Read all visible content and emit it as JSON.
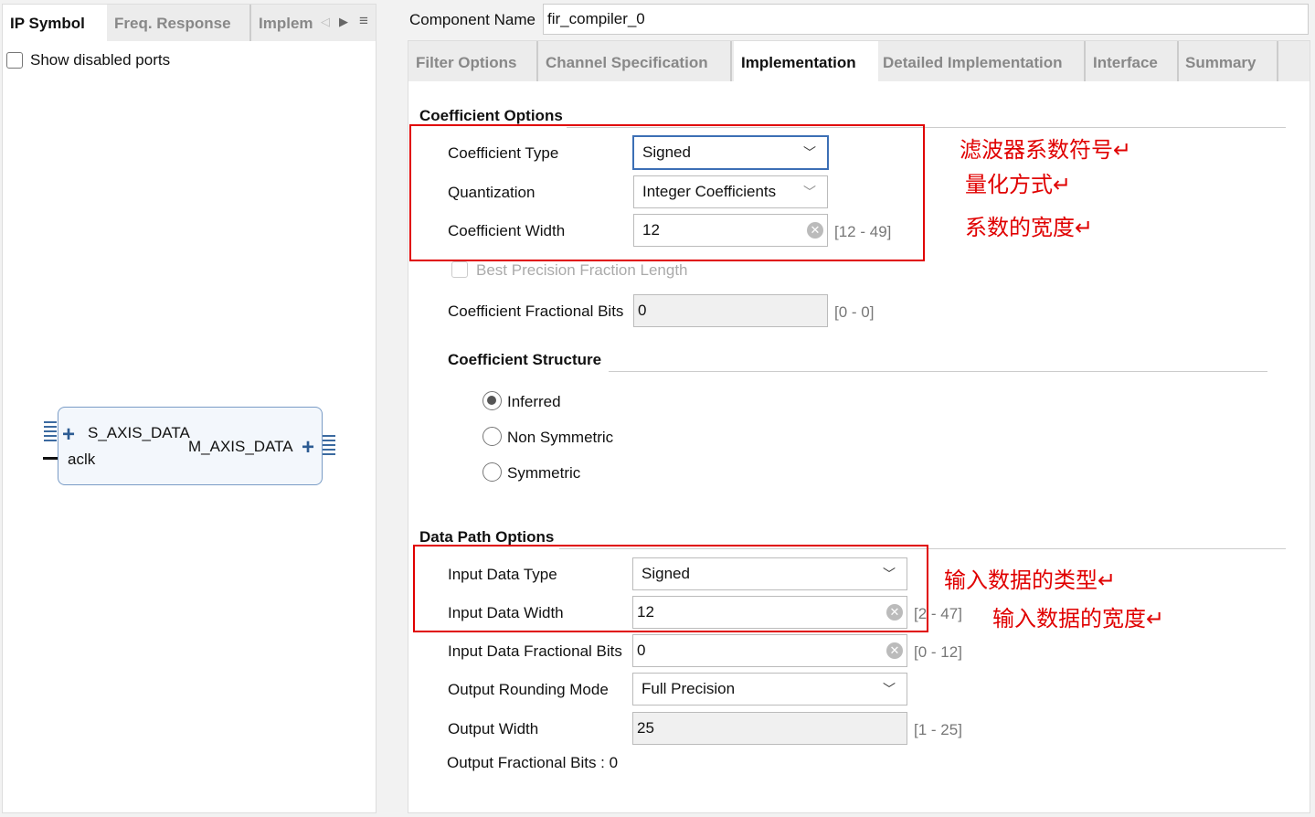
{
  "left_panel": {
    "tabs": [
      "IP Symbol",
      "Freq. Response",
      "Implem"
    ],
    "show_disabled_ports": "Show disabled ports",
    "symbol": {
      "s_axis": "S_AXIS_DATA",
      "m_axis": "M_AXIS_DATA",
      "aclk": "aclk"
    }
  },
  "component": {
    "label": "Component Name",
    "value": "fir_compiler_0"
  },
  "tabs": [
    "Filter Options",
    "Channel Specification",
    "Implementation",
    "Detailed Implementation",
    "Interface",
    "Summary"
  ],
  "coef": {
    "title": "Coefficient Options",
    "type_label": "Coefficient Type",
    "type_value": "Signed",
    "quant_label": "Quantization",
    "quant_value": "Integer Coefficients",
    "width_label": "Coefficient Width",
    "width_value": "12",
    "width_range": "[12 - 49]",
    "best_precision": "Best Precision Fraction Length",
    "frac_label": "Coefficient Fractional Bits",
    "frac_value": "0",
    "frac_range": "[0 - 0]"
  },
  "structure": {
    "title": "Coefficient Structure",
    "options": [
      "Inferred",
      "Non Symmetric",
      "Symmetric"
    ],
    "selected": "Inferred"
  },
  "datapath": {
    "title": "Data Path Options",
    "in_type_label": "Input Data Type",
    "in_type_value": "Signed",
    "in_width_label": "Input Data Width",
    "in_width_value": "12",
    "in_width_range": "[2 - 47]",
    "in_frac_label": "Input Data Fractional Bits",
    "in_frac_value": "0",
    "in_frac_range": "[0 - 12]",
    "round_label": "Output Rounding Mode",
    "round_value": "Full Precision",
    "out_width_label": "Output Width",
    "out_width_value": "25",
    "out_width_range": "[1 - 25]",
    "out_frac": "Output Fractional Bits : 0"
  },
  "annotations": [
    "滤波器系数符号↵",
    "量化方式↵",
    "系数的宽度↵",
    "输入数据的类型↵",
    "输入数据的宽度↵"
  ],
  "colors": {
    "annotation": "#e00000",
    "focus": "#3c6fb5"
  }
}
